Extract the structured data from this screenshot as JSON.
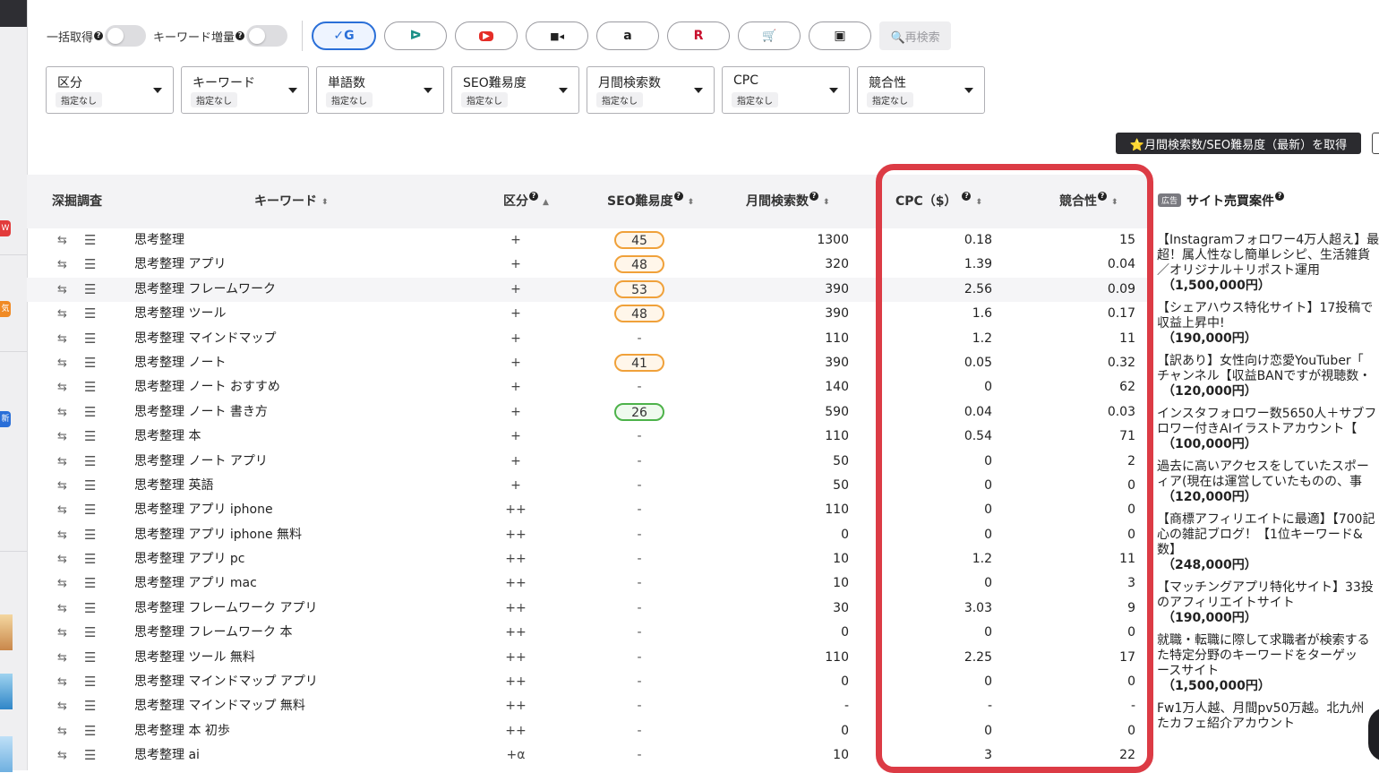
{
  "toolbar": {
    "bulk_label": "一括取得",
    "expand_label": "キーワード増量",
    "help_mark": "?",
    "engines": [
      {
        "name": "google",
        "glyph": "✓G",
        "color": "#2a6fd8"
      },
      {
        "name": "bing",
        "glyph": "ᐅ",
        "color": "#1a8f86"
      },
      {
        "name": "youtube",
        "glyph": "▶",
        "color": "#e52d27"
      },
      {
        "name": "video",
        "glyph": "■◂",
        "color": "#222222"
      },
      {
        "name": "amazon",
        "glyph": "a",
        "color": "#222222"
      },
      {
        "name": "rakuten",
        "glyph": "R",
        "color": "#c8102e"
      },
      {
        "name": "shopping",
        "glyph": "🛒",
        "color": "#222222"
      },
      {
        "name": "image",
        "glyph": "▣",
        "color": "#222222"
      }
    ],
    "rescan_label": "🔍再検索"
  },
  "filters": [
    {
      "title": "区分",
      "value": "指定なし"
    },
    {
      "title": "キーワード",
      "value": "指定なし"
    },
    {
      "title": "単語数",
      "value": "指定なし"
    },
    {
      "title": "SEO難易度",
      "value": "指定なし"
    },
    {
      "title": "月間検索数",
      "value": "指定なし"
    },
    {
      "title": "CPC",
      "value": "指定なし"
    },
    {
      "title": "競合性",
      "value": "指定なし"
    }
  ],
  "get_button": "⭐月間検索数/SEO難易度（最新）を取得",
  "table": {
    "headers": {
      "deep": "深掘調査",
      "keyword": "キーワード",
      "category": "区分",
      "seo": "SEO難易度",
      "volume": "月間検索数",
      "cpc": "CPC（$）",
      "competition": "競合性"
    },
    "rows": [
      {
        "keyword": "思考整理",
        "category": "+",
        "seo": "45",
        "seo_color": "orange",
        "volume": "1300",
        "cpc": "0.18",
        "competition": "15"
      },
      {
        "keyword": "思考整理 アプリ",
        "category": "+",
        "seo": "48",
        "seo_color": "orange",
        "volume": "320",
        "cpc": "1.39",
        "competition": "0.04"
      },
      {
        "keyword": "思考整理 フレームワーク",
        "category": "+",
        "seo": "53",
        "seo_color": "orange",
        "volume": "390",
        "cpc": "2.56",
        "competition": "0.09"
      },
      {
        "keyword": "思考整理 ツール",
        "category": "+",
        "seo": "48",
        "seo_color": "orange",
        "volume": "390",
        "cpc": "1.6",
        "competition": "0.17"
      },
      {
        "keyword": "思考整理 マインドマップ",
        "category": "+",
        "seo": "-",
        "seo_color": "",
        "volume": "110",
        "cpc": "1.2",
        "competition": "11"
      },
      {
        "keyword": "思考整理 ノート",
        "category": "+",
        "seo": "41",
        "seo_color": "orange",
        "volume": "390",
        "cpc": "0.05",
        "competition": "0.32"
      },
      {
        "keyword": "思考整理 ノート おすすめ",
        "category": "+",
        "seo": "-",
        "seo_color": "",
        "volume": "140",
        "cpc": "0",
        "competition": "62"
      },
      {
        "keyword": "思考整理 ノート 書き方",
        "category": "+",
        "seo": "26",
        "seo_color": "green",
        "volume": "590",
        "cpc": "0.04",
        "competition": "0.03"
      },
      {
        "keyword": "思考整理 本",
        "category": "+",
        "seo": "-",
        "seo_color": "",
        "volume": "110",
        "cpc": "0.54",
        "competition": "71"
      },
      {
        "keyword": "思考整理 ノート アプリ",
        "category": "+",
        "seo": "-",
        "seo_color": "",
        "volume": "50",
        "cpc": "0",
        "competition": "2"
      },
      {
        "keyword": "思考整理 英語",
        "category": "+",
        "seo": "-",
        "seo_color": "",
        "volume": "50",
        "cpc": "0",
        "competition": "0"
      },
      {
        "keyword": "思考整理 アプリ iphone",
        "category": "++",
        "seo": "-",
        "seo_color": "",
        "volume": "110",
        "cpc": "0",
        "competition": "0"
      },
      {
        "keyword": "思考整理 アプリ iphone 無料",
        "category": "++",
        "seo": "-",
        "seo_color": "",
        "volume": "0",
        "cpc": "0",
        "competition": "0"
      },
      {
        "keyword": "思考整理 アプリ pc",
        "category": "++",
        "seo": "-",
        "seo_color": "",
        "volume": "10",
        "cpc": "1.2",
        "competition": "11"
      },
      {
        "keyword": "思考整理 アプリ mac",
        "category": "++",
        "seo": "-",
        "seo_color": "",
        "volume": "10",
        "cpc": "0",
        "competition": "3"
      },
      {
        "keyword": "思考整理 フレームワーク アプリ",
        "category": "++",
        "seo": "-",
        "seo_color": "",
        "volume": "30",
        "cpc": "3.03",
        "competition": "9"
      },
      {
        "keyword": "思考整理 フレームワーク 本",
        "category": "++",
        "seo": "-",
        "seo_color": "",
        "volume": "0",
        "cpc": "0",
        "competition": "0"
      },
      {
        "keyword": "思考整理 ツール 無料",
        "category": "++",
        "seo": "-",
        "seo_color": "",
        "volume": "110",
        "cpc": "2.25",
        "competition": "17"
      },
      {
        "keyword": "思考整理 マインドマップ アプリ",
        "category": "++",
        "seo": "-",
        "seo_color": "",
        "volume": "0",
        "cpc": "0",
        "competition": "0"
      },
      {
        "keyword": "思考整理 マインドマップ 無料",
        "category": "++",
        "seo": "-",
        "seo_color": "",
        "volume": "-",
        "cpc": "-",
        "competition": "-"
      },
      {
        "keyword": "思考整理 本 初歩",
        "category": "++",
        "seo": "-",
        "seo_color": "",
        "volume": "0",
        "cpc": "0",
        "competition": "0"
      },
      {
        "keyword": "思考整理 ai",
        "category": "+α",
        "seo": "-",
        "seo_color": "",
        "volume": "10",
        "cpc": "3",
        "competition": "22"
      }
    ]
  },
  "ads_panel": {
    "tag": "広告",
    "title": "サイト売買案件",
    "items": [
      {
        "title": "【Instagramフォロワー4万人超え】最\n超！属人性なし簡単レシピ、生活雑貨\n／オリジナル＋リポスト運用",
        "price": "（1,500,000円）"
      },
      {
        "title": "【シェアハウス特化サイト】17投稿で\n収益上昇中!",
        "price": "（190,000円）"
      },
      {
        "title": "【訳あり】女性向け恋愛YouTuber「\nチャンネル【収益BANですが視聴数・",
        "price": "（120,000円）"
      },
      {
        "title": "インスタフォロワー数5650人＋サブフ\nロワー付きAIイラストアカウント【",
        "price": "（100,000円）"
      },
      {
        "title": "過去に高いアクセスをしていたスポー\nィア(現在は運営していたものの、事",
        "price": "（120,000円）"
      },
      {
        "title": "【商標アフィリエイトに最適】【700記\n心の雑記ブログ！【1位キーワード&\n数】",
        "price": "（248,000円）"
      },
      {
        "title": "【マッチングアプリ特化サイト】33投\nのアフィリエイトサイト",
        "price": "（190,000円）"
      },
      {
        "title": "就職・転職に際して求職者が検索する\nた特定分野のキーワードをターゲッ\nースサイト",
        "price": "（1,500,000円）"
      },
      {
        "title": "Fw1万人越、月間pv50万越。北九州\nたカフェ紹介アカウント",
        "price": ""
      }
    ]
  }
}
